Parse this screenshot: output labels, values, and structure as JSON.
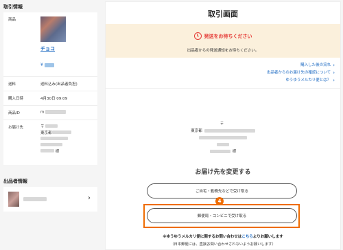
{
  "left": {
    "transaction_title": "取引情報",
    "product_label": "商品",
    "item_name": "チョコ",
    "price_prefix": "¥",
    "shipping_label": "送料",
    "shipping_value": "送料込み(出品者負担)",
    "purchase_date_label": "購入日時",
    "purchase_date_value": "4月30日 09:09",
    "product_id_label": "商品ID",
    "product_id_prefix": "m",
    "delivery_label": "お届け先",
    "delivery_postal_prefix": "〒",
    "delivery_city": "東京都",
    "delivery_suffix": "様",
    "seller_title": "出品者情報",
    "seller_chevron": "›"
  },
  "right": {
    "title": "取引画面",
    "banner_title": "発送をお待ちください",
    "banner_text": "出品者からの発送通知をお待ちください。",
    "links": [
      {
        "label": "購入した後の流れ",
        "arrow": "›"
      },
      {
        "label": "出品者からのお届け先の確認について",
        "arrow": "›"
      },
      {
        "label": "ゆうゆうメルカリ便とは？",
        "arrow": "›"
      }
    ],
    "address": {
      "postal_prefix": "〒",
      "city": "東京都",
      "suffix": "様"
    },
    "change_title": "お届け先を変更する",
    "button_home": "ご自宅・勤務先などで受け取る",
    "button_post": "郵便局・コンビニで受け取る",
    "step_number": "4",
    "note_before": "※ゆうゆうメルカリ便に関するお問い合わせは",
    "note_link": "こちら",
    "note_after": "よりお願いします",
    "note_sub": "（日本郵便には、直接お問い合わせされないようお願いします）"
  },
  "colors": {
    "accent_link": "#1565c0",
    "alert_red": "#e53935",
    "banner_bg": "#fbf0dc",
    "highlight_orange": "#ef6c00"
  }
}
